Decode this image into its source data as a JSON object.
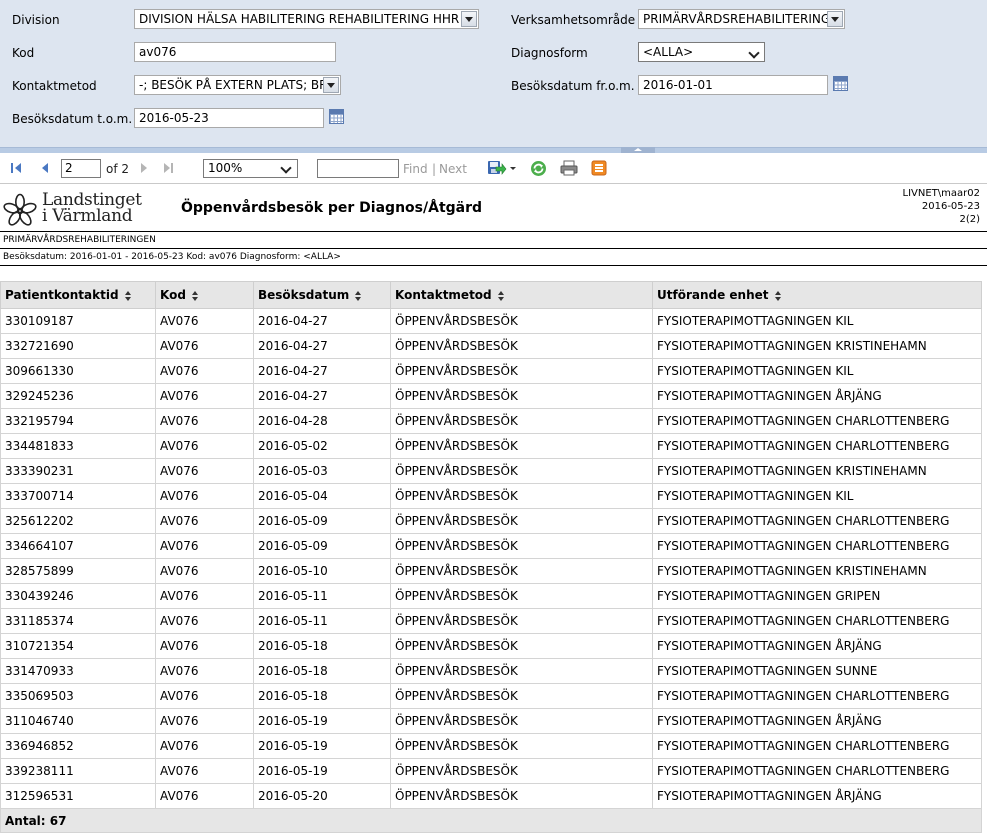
{
  "params": {
    "division_label": "Division",
    "division_value": "DIVISION HÄLSA HABILITERING REHABILITERING HHR",
    "verksamhet_label": "Verksamhetsområde",
    "verksamhet_value": "PRIMÄRVÅRDSREHABILITERINGEN",
    "kod_label": "Kod",
    "kod_value": "av076",
    "diagnosform_label": "Diagnosform",
    "diagnosform_value": "<ALLA>",
    "kontaktmetod_label": "Kontaktmetod",
    "kontaktmetod_value": "-; BESÖK PÅ EXTERN PLATS; BREV",
    "from_label": "Besöksdatum fr.o.m.",
    "from_value": "2016-01-01",
    "tom_label": "Besöksdatum t.o.m.",
    "tom_value": "2016-05-23"
  },
  "toolbar": {
    "page_value": "2",
    "of_text": "of 2",
    "zoom_value": "100%",
    "find_label": "Find",
    "separator": "|",
    "next_label": "Next"
  },
  "report": {
    "logo_line1": "Landstinget",
    "logo_line2": "i Värmland",
    "title": "Öppenvårdsbesök per Diagnos/Åtgärd",
    "user": "LIVNET\\maar02",
    "date": "2016-05-23",
    "page": "2(2)",
    "subtitle": "PRIMÄRVÅRDSREHABILITERINGEN",
    "filter_line": "Besöksdatum: 2016-01-01 - 2016-05-23 Kod: av076 Diagnosform: <ALLA>"
  },
  "table": {
    "headers": [
      "Patientkontaktid",
      "Kod",
      "Besöksdatum",
      "Kontaktmetod",
      "Utförande enhet"
    ],
    "rows": [
      [
        "330109187",
        "AV076",
        "2016-04-27",
        "ÖPPENVÅRDSBESÖK",
        "FYSIOTERAPIMOTTAGNINGEN KIL"
      ],
      [
        "332721690",
        "AV076",
        "2016-04-27",
        "ÖPPENVÅRDSBESÖK",
        "FYSIOTERAPIMOTTAGNINGEN KRISTINEHAMN"
      ],
      [
        "309661330",
        "AV076",
        "2016-04-27",
        "ÖPPENVÅRDSBESÖK",
        "FYSIOTERAPIMOTTAGNINGEN KIL"
      ],
      [
        "329245236",
        "AV076",
        "2016-04-27",
        "ÖPPENVÅRDSBESÖK",
        "FYSIOTERAPIMOTTAGNINGEN ÅRJÄNG"
      ],
      [
        "332195794",
        "AV076",
        "2016-04-28",
        "ÖPPENVÅRDSBESÖK",
        "FYSIOTERAPIMOTTAGNINGEN CHARLOTTENBERG"
      ],
      [
        "334481833",
        "AV076",
        "2016-05-02",
        "ÖPPENVÅRDSBESÖK",
        "FYSIOTERAPIMOTTAGNINGEN CHARLOTTENBERG"
      ],
      [
        "333390231",
        "AV076",
        "2016-05-03",
        "ÖPPENVÅRDSBESÖK",
        "FYSIOTERAPIMOTTAGNINGEN KRISTINEHAMN"
      ],
      [
        "333700714",
        "AV076",
        "2016-05-04",
        "ÖPPENVÅRDSBESÖK",
        "FYSIOTERAPIMOTTAGNINGEN KIL"
      ],
      [
        "325612202",
        "AV076",
        "2016-05-09",
        "ÖPPENVÅRDSBESÖK",
        "FYSIOTERAPIMOTTAGNINGEN CHARLOTTENBERG"
      ],
      [
        "334664107",
        "AV076",
        "2016-05-09",
        "ÖPPENVÅRDSBESÖK",
        "FYSIOTERAPIMOTTAGNINGEN CHARLOTTENBERG"
      ],
      [
        "328575899",
        "AV076",
        "2016-05-10",
        "ÖPPENVÅRDSBESÖK",
        "FYSIOTERAPIMOTTAGNINGEN KRISTINEHAMN"
      ],
      [
        "330439246",
        "AV076",
        "2016-05-11",
        "ÖPPENVÅRDSBESÖK",
        "FYSIOTERAPIMOTTAGNINGEN GRIPEN"
      ],
      [
        "331185374",
        "AV076",
        "2016-05-11",
        "ÖPPENVÅRDSBESÖK",
        "FYSIOTERAPIMOTTAGNINGEN CHARLOTTENBERG"
      ],
      [
        "310721354",
        "AV076",
        "2016-05-18",
        "ÖPPENVÅRDSBESÖK",
        "FYSIOTERAPIMOTTAGNINGEN ÅRJÄNG"
      ],
      [
        "331470933",
        "AV076",
        "2016-05-18",
        "ÖPPENVÅRDSBESÖK",
        "FYSIOTERAPIMOTTAGNINGEN SUNNE"
      ],
      [
        "335069503",
        "AV076",
        "2016-05-18",
        "ÖPPENVÅRDSBESÖK",
        "FYSIOTERAPIMOTTAGNINGEN CHARLOTTENBERG"
      ],
      [
        "311046740",
        "AV076",
        "2016-05-19",
        "ÖPPENVÅRDSBESÖK",
        "FYSIOTERAPIMOTTAGNINGEN ÅRJÄNG"
      ],
      [
        "336946852",
        "AV076",
        "2016-05-19",
        "ÖPPENVÅRDSBESÖK",
        "FYSIOTERAPIMOTTAGNINGEN CHARLOTTENBERG"
      ],
      [
        "339238111",
        "AV076",
        "2016-05-19",
        "ÖPPENVÅRDSBESÖK",
        "FYSIOTERAPIMOTTAGNINGEN CHARLOTTENBERG"
      ],
      [
        "312596531",
        "AV076",
        "2016-05-20",
        "ÖPPENVÅRDSBESÖK",
        "FYSIOTERAPIMOTTAGNINGEN ÅRJÄNG"
      ]
    ],
    "footer": "Antal: 67"
  },
  "icons": {
    "first_page": "first-page-icon",
    "prev_page": "prev-page-icon",
    "next_page": "next-page-icon",
    "last_page": "last-page-icon",
    "export": "export-icon",
    "refresh": "refresh-icon",
    "print": "print-icon",
    "data_feed": "data-feed-icon",
    "calendar": "calendar-icon",
    "logo_flower": "flower-logo-icon"
  },
  "colors": {
    "param_bg": "#dde5f0",
    "nav_blue": "#4a78c2",
    "header_bg": "#e6e6e6"
  }
}
